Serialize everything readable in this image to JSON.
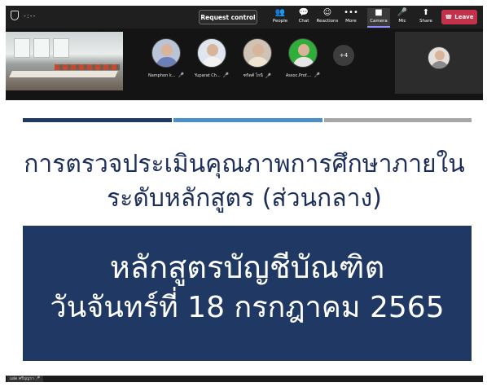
{
  "toolbar": {
    "timer": "-:--",
    "request_control": "Request control",
    "buttons": [
      {
        "label": "People",
        "icon": "people-icon",
        "glyph": "👥"
      },
      {
        "label": "Chat",
        "icon": "chat-icon",
        "glyph": "💬"
      },
      {
        "label": "Reactions",
        "icon": "reactions-icon",
        "glyph": "☺"
      },
      {
        "label": "More",
        "icon": "more-icon",
        "glyph": "•••"
      },
      {
        "label": "Camera",
        "icon": "camera-icon",
        "glyph": "■"
      },
      {
        "label": "Mic",
        "icon": "mic-off-icon",
        "glyph": "🎤"
      },
      {
        "label": "Share",
        "icon": "share-icon",
        "glyph": "⬆"
      }
    ],
    "leave": "Leave",
    "leave_color": "#c4314b"
  },
  "participants": [
    {
      "name": "Namphon k...",
      "shirt": "#6c7fb8"
    },
    {
      "name": "Yuparat Ch...",
      "shirt": "#e8e8e8"
    },
    {
      "name": "ฑริตศ์ โกนี",
      "shirt": "#f0e3d0"
    },
    {
      "name": "Assoc.Prof....",
      "shirt": "#e6e6e6"
    }
  ],
  "more_participants": "+4",
  "slide": {
    "bar_colors": [
      "#1f3864",
      "#4a90c8",
      "#a6a6a6"
    ],
    "title_line1": "การตรวจประเมินคุณภาพการศึกษาภายใน",
    "title_line2": "ระดับหลักสูตร (ส่วนกลาง)",
    "box_line1": "หลักสูตรบัญชีบัณฑิต",
    "box_line2": "วันจันทร์ที่ 18 กรกฎาคม 2565",
    "box_color": "#1f3864"
  },
  "presenter_label": "แฝด ศรีบุญรา"
}
